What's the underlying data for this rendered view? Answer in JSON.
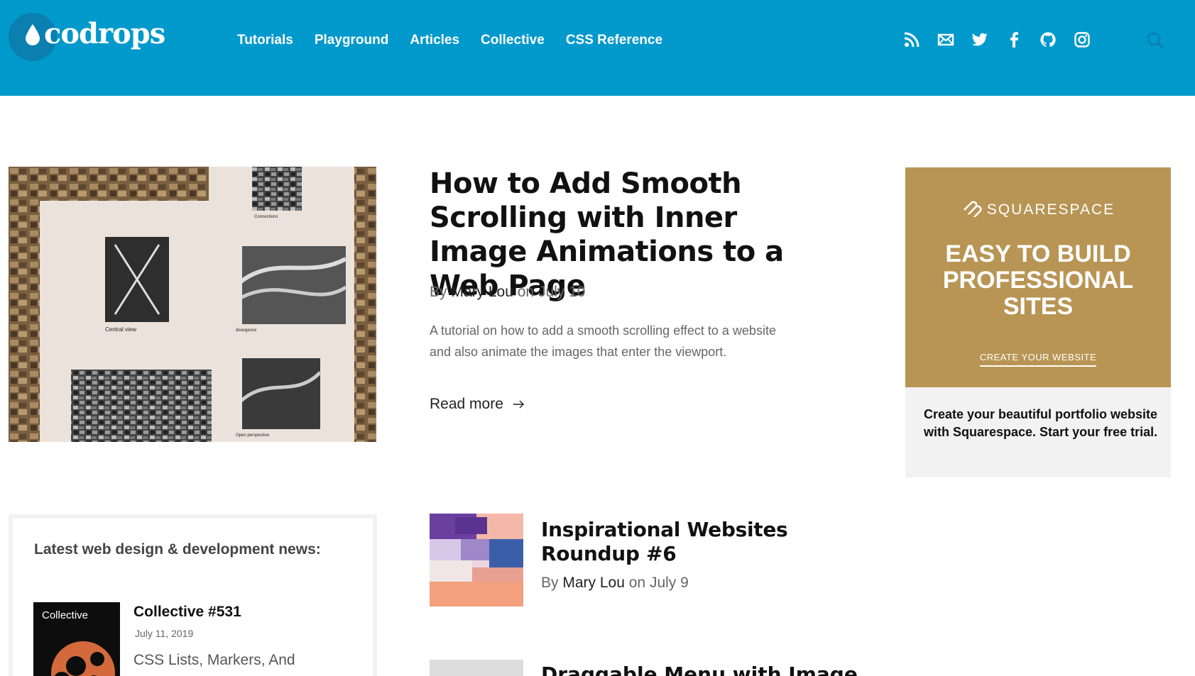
{
  "brand": {
    "logo_text": "codrops"
  },
  "nav": [
    "Tutorials",
    "Playground",
    "Articles",
    "Collective",
    "CSS Reference"
  ],
  "social_icons": [
    "rss-icon",
    "mail-icon",
    "twitter-icon",
    "facebook-icon",
    "github-icon",
    "instagram-icon"
  ],
  "search": {
    "icon": "search-icon"
  },
  "featured": {
    "title": "How to Add Smooth Scrolling with Inner Image Animations to a Web Page",
    "by": "By",
    "author": "Mary Lou",
    "on_date": "on July 10",
    "excerpt": "A tutorial on how to add a smooth scrolling effect to a website and also animate the images that enter the viewport.",
    "read_more": "Read more",
    "image_labels": [
      "Central view",
      "Connections",
      "divergence",
      "Open perspective"
    ]
  },
  "ad": {
    "brand": "SQUARESPACE",
    "headline": "EASY TO BUILD PROFESSIONAL SITES",
    "cta": "CREATE YOUR WEBSITE",
    "text": "Create your beautiful portfolio website with Squarespace. Start your free trial."
  },
  "news": {
    "heading": "Latest web design & development news:",
    "thumb_label": "Collective",
    "item_title": "Collective #531",
    "item_date": "July 11, 2019",
    "item_text": "CSS Lists, Markers, And"
  },
  "articles": [
    {
      "title": "Inspirational Websites Roundup #6",
      "by": "By",
      "author": "Mary Lou",
      "on_date": "on July 9"
    },
    {
      "title": "Draggable Menu with Image"
    }
  ],
  "colors": {
    "header": "#0099cc",
    "ad": "#b89554",
    "ad_panel": "#f2f2f2"
  }
}
